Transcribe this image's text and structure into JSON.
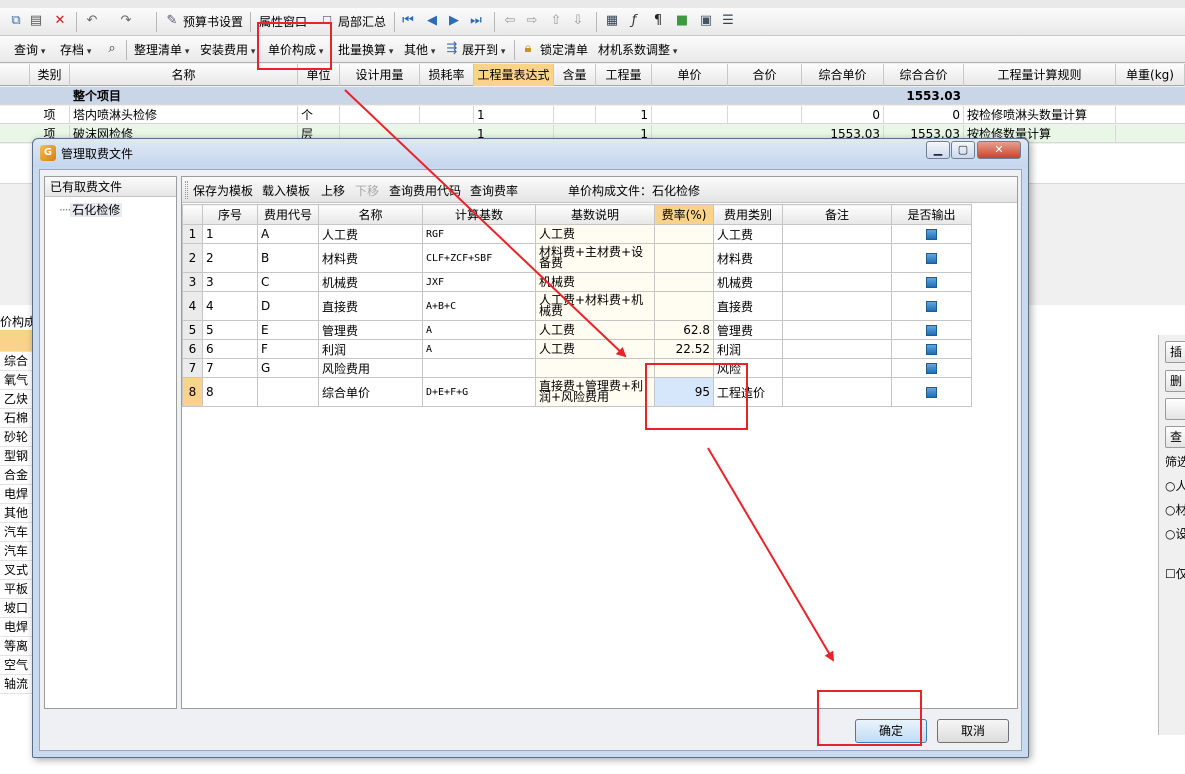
{
  "toolbar1": {
    "budget_settings": "预算书设置",
    "properties_window": "属性窗口",
    "local_summary": "局部汇总"
  },
  "toolbar2": {
    "query": "查询",
    "save": "存档",
    "organize_list": "整理清单",
    "install_fee": "安装费用",
    "unit_price_comp": "单价构成",
    "batch_convert": "批量换算",
    "other": "其他",
    "expand_to": "展开到",
    "lock_list": "锁定清单",
    "material_adjust": "材机系数调整"
  },
  "grid": {
    "headers": [
      "类别",
      "名称",
      "单位",
      "设计用量",
      "损耗率",
      "工程量表达式",
      "含量",
      "工程量",
      "单价",
      "合价",
      "综合单价",
      "综合合价",
      "工程量计算规则",
      "单重(kg)"
    ],
    "summary_row": {
      "name": "整个项目",
      "total": "1553.03"
    },
    "rows": [
      {
        "type": "项",
        "name": "塔内喷淋头检修",
        "unit": "个",
        "expr": "1",
        "qty": "1",
        "unit_total": "0",
        "total": "0",
        "rule": "按检修喷淋头数量计算"
      },
      {
        "type": "项",
        "name": "破沫网检修",
        "unit": "层",
        "expr": "1",
        "qty": "1",
        "unit_total": "1553.03",
        "total": "1553.03",
        "rule": "按检修数量计算"
      }
    ]
  },
  "lower_panel": {
    "tab_label": "价构成",
    "left_items": [
      "综合",
      "氧气",
      "乙炔",
      "石棉",
      "砂轮",
      "型钢",
      "合金",
      "电焊",
      "其他",
      "汽车",
      "汽车",
      "叉式",
      "平板",
      "坡口",
      "电焊",
      "等离",
      "空气",
      "轴流"
    ],
    "right_buttons": [
      "插",
      "删",
      "",
      "查"
    ],
    "filter_label": "筛选",
    "radios": [
      "人",
      "材",
      "设"
    ],
    "checkbox": "仅"
  },
  "dialog": {
    "title": "管理取费文件",
    "tree_header": "已有取费文件",
    "tree_items": [
      "石化检修"
    ],
    "toolbar": {
      "save_template": "保存为模板",
      "load_template": "载入模板",
      "move_up": "上移",
      "move_down": "下移",
      "query_code": "查询费用代码",
      "query_rate": "查询费率"
    },
    "file_label": "单价构成文件：石化检修",
    "columns": [
      "序号",
      "费用代号",
      "名称",
      "计算基数",
      "基数说明",
      "费率(%)",
      "费用类别",
      "备注",
      "是否输出"
    ],
    "rows": [
      {
        "rn": "1",
        "seq": "1",
        "code": "A",
        "name": "人工费",
        "base": "RGF",
        "desc": "人工费",
        "rate": "",
        "cat": "人工费",
        "note": ""
      },
      {
        "rn": "2",
        "seq": "2",
        "code": "B",
        "name": "材料费",
        "base": "CLF+ZCF+SBF",
        "desc": "材料费+主材费+设备费",
        "rate": "",
        "cat": "材料费",
        "note": ""
      },
      {
        "rn": "3",
        "seq": "3",
        "code": "C",
        "name": "机械费",
        "base": "JXF",
        "desc": "机械费",
        "rate": "",
        "cat": "机械费",
        "note": ""
      },
      {
        "rn": "4",
        "seq": "4",
        "code": "D",
        "name": "直接费",
        "base": "A+B+C",
        "desc": "人工费+材料费+机械费",
        "rate": "",
        "cat": "直接费",
        "note": ""
      },
      {
        "rn": "5",
        "seq": "5",
        "code": "E",
        "name": "管理费",
        "base": "A",
        "desc": "人工费",
        "rate": "62.8",
        "cat": "管理费",
        "note": ""
      },
      {
        "rn": "6",
        "seq": "6",
        "code": "F",
        "name": "利润",
        "base": "A",
        "desc": "人工费",
        "rate": "22.52",
        "cat": "利润",
        "note": ""
      },
      {
        "rn": "7",
        "seq": "7",
        "code": "G",
        "name": "风险费用",
        "base": "",
        "desc": "",
        "rate": "",
        "cat": "风险",
        "note": ""
      },
      {
        "rn": "8",
        "seq": "8",
        "code": "",
        "name": "综合单价",
        "base": "D+E+F+G",
        "desc": "直接费+管理费+利润+风险费用",
        "rate": "95",
        "cat": "工程造价",
        "note": ""
      }
    ],
    "ok": "确定",
    "cancel": "取消"
  },
  "colors": {
    "annotation": "#e8232a",
    "header_highlight": "#fad38a",
    "summary_row": "#c9d6e8"
  }
}
